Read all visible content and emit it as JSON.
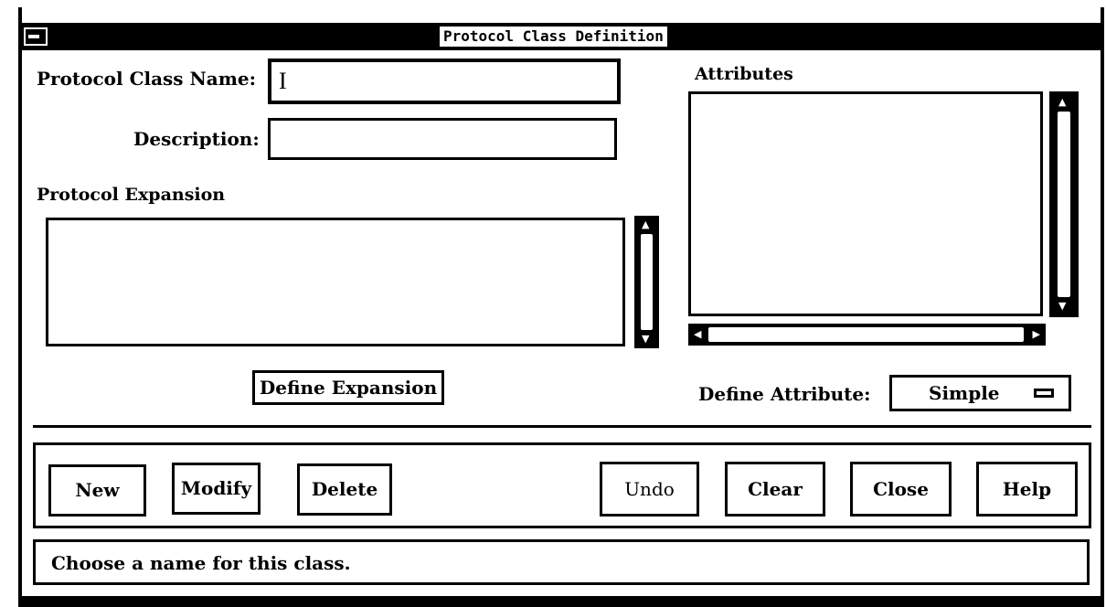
{
  "window": {
    "title": "Protocol Class Definition"
  },
  "form": {
    "name_label": "Protocol Class Name:",
    "name_value": "",
    "description_label": "Description:",
    "description_value": ""
  },
  "expansion": {
    "heading": "Protocol Expansion",
    "define_button": "Define Expansion"
  },
  "attributes": {
    "heading": "Attributes",
    "define_label": "Define Attribute:",
    "define_selected": "Simple"
  },
  "buttons": {
    "new": "New",
    "modify": "Modify",
    "delete": "Delete",
    "undo": "Undo",
    "clear": "Clear",
    "close": "Close",
    "help": "Help"
  },
  "status": {
    "message": "Choose a name for this class."
  },
  "icons": {
    "window_menu": "window-menu-icon",
    "scroll_up": "arrow-up-icon",
    "scroll_down": "arrow-down-icon",
    "scroll_left": "arrow-left-icon",
    "scroll_right": "arrow-right-icon",
    "option_menu": "option-menu-icon"
  },
  "colors": {
    "foreground": "#000000",
    "background": "#ffffff"
  }
}
